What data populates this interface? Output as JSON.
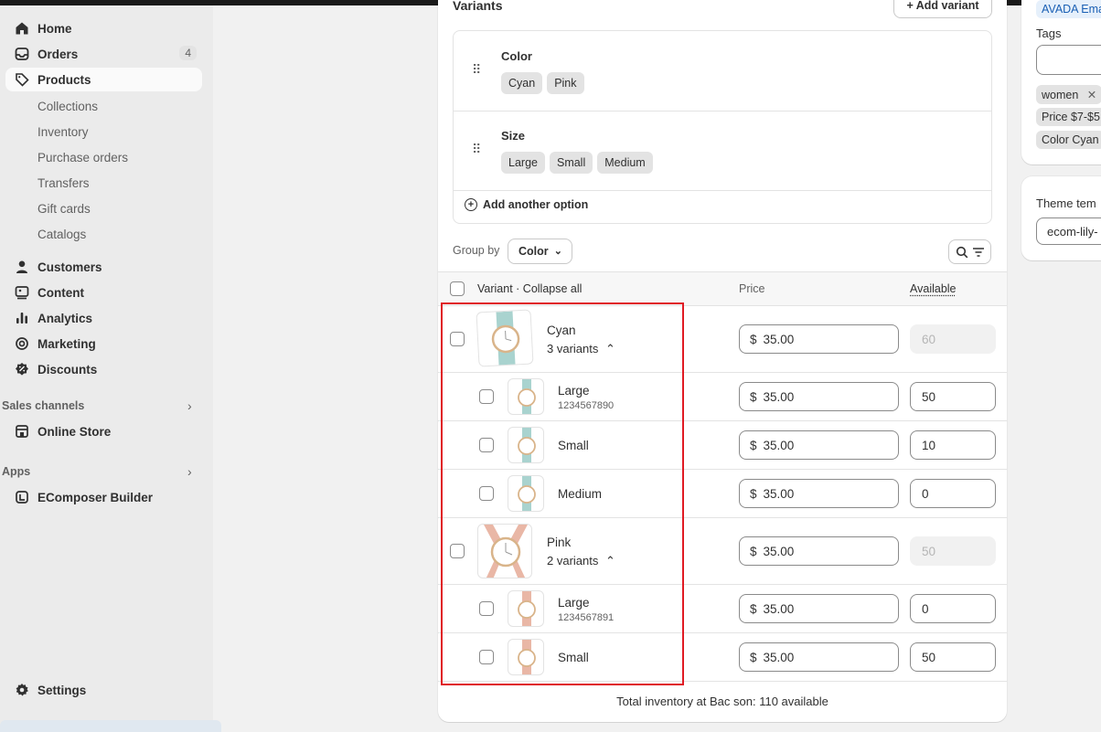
{
  "sidebar": {
    "items": [
      {
        "label": "Home",
        "icon": "home-icon"
      },
      {
        "label": "Orders",
        "icon": "inbox-icon",
        "badge": "4"
      },
      {
        "label": "Products",
        "icon": "tag-icon"
      }
    ],
    "products_sub": [
      "Collections",
      "Inventory",
      "Purchase orders",
      "Transfers",
      "Gift cards",
      "Catalogs"
    ],
    "items2": [
      {
        "label": "Customers",
        "icon": "person-icon"
      },
      {
        "label": "Content",
        "icon": "content-icon"
      },
      {
        "label": "Analytics",
        "icon": "bar-chart-icon"
      },
      {
        "label": "Marketing",
        "icon": "target-icon"
      },
      {
        "label": "Discounts",
        "icon": "discount-icon"
      }
    ],
    "sales_channels_label": "Sales channels",
    "online_store": "Online Store",
    "apps_label": "Apps",
    "ecomposer": "EComposer Builder",
    "settings": "Settings"
  },
  "variants_card": {
    "title": "Variants",
    "add_variant": "+ Add variant",
    "options": [
      {
        "name": "Color",
        "values": [
          "Cyan",
          "Pink"
        ]
      },
      {
        "name": "Size",
        "values": [
          "Large",
          "Small",
          "Medium"
        ]
      }
    ],
    "add_option": "Add another option",
    "group_by_label": "Group by",
    "group_by_value": "Color",
    "table": {
      "col_variant": "Variant · Collapse all",
      "col_price": "Price",
      "col_available": "Available"
    },
    "groups": [
      {
        "name": "Cyan",
        "count_label": "3 variants",
        "price": "35.00",
        "available": "60",
        "children": [
          {
            "name": "Large",
            "sku": "1234567890",
            "price": "35.00",
            "available": "50"
          },
          {
            "name": "Small",
            "sku": "",
            "price": "35.00",
            "available": "10"
          },
          {
            "name": "Medium",
            "sku": "",
            "price": "35.00",
            "available": "0"
          }
        ]
      },
      {
        "name": "Pink",
        "count_label": "2 variants",
        "price": "35.00",
        "available": "50",
        "children": [
          {
            "name": "Large",
            "sku": "1234567891",
            "price": "35.00",
            "available": "0"
          },
          {
            "name": "Small",
            "sku": "",
            "price": "35.00",
            "available": "50"
          }
        ]
      }
    ],
    "currency": "$",
    "total": "Total inventory at Bac son: 110 available"
  },
  "right_panel": {
    "avada_chip": "AVADA Ema",
    "tags_label": "Tags",
    "tags": [
      "women",
      "Price $7-$5",
      "Color Cyan"
    ],
    "theme_label": "Theme tem",
    "theme_value": "ecom-lily-"
  },
  "colors": {
    "highlight": "#e01b24",
    "cyan_strap": "#a9d3cf",
    "pink_strap": "#e9b7a6"
  }
}
